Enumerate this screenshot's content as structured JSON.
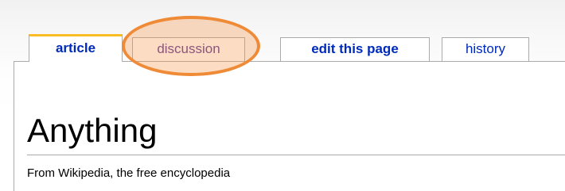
{
  "tabs": [
    {
      "label": "article",
      "selected": true
    },
    {
      "label": "discussion",
      "selected": false
    },
    {
      "label": "edit this page",
      "selected": false
    },
    {
      "label": "history",
      "selected": false
    }
  ],
  "page": {
    "title": "Anything",
    "subtitle": "From Wikipedia, the free encyclopedia"
  },
  "colors": {
    "link": "#002bb8",
    "selected_tab_accent": "#fabd23",
    "highlight_circle": "#ef8a37",
    "border": "#aaaaaa"
  }
}
